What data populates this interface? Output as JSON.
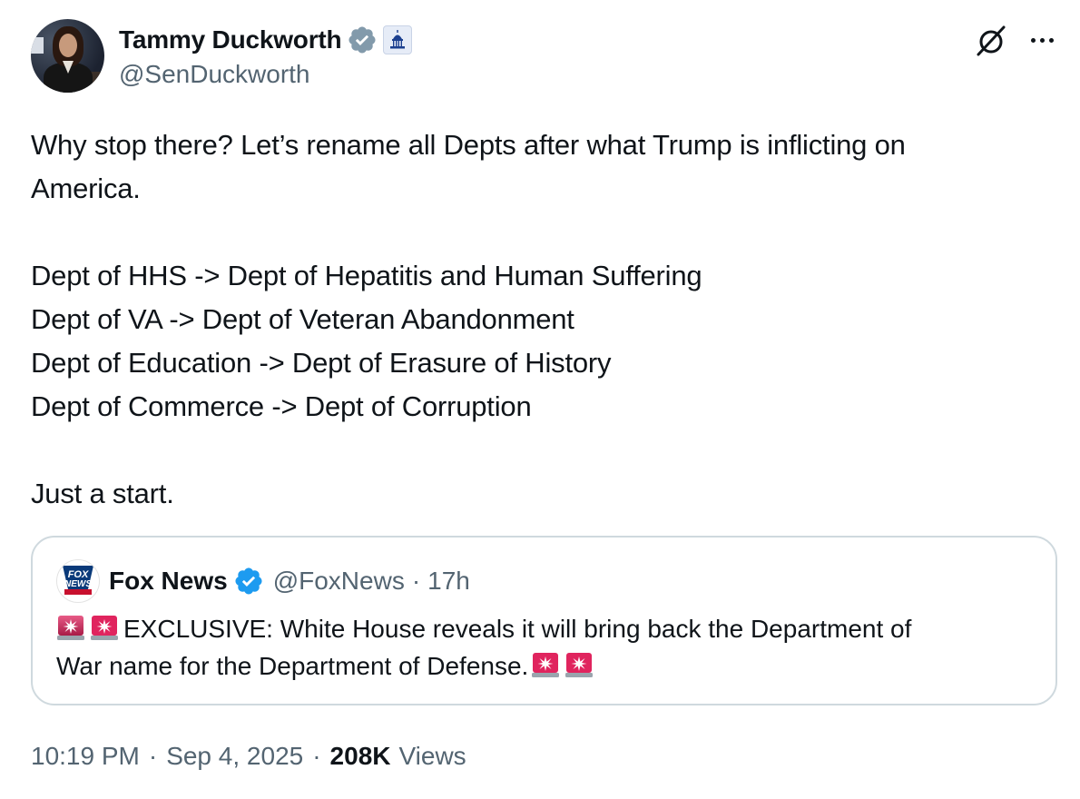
{
  "author": {
    "display_name": "Tammy Duckworth",
    "handle": "@SenDuckworth",
    "verified_badge": "gray-verified-badge-icon",
    "affiliation_icon": "us-capitol-icon"
  },
  "header_actions": {
    "grok_icon": "grok-icon",
    "more_icon": "more-icon"
  },
  "tweet": {
    "lines": [
      "Why stop there? Let’s rename all Depts after what Trump is inflicting on",
      "America.",
      "",
      "Dept of HHS -> Dept of Hepatitis and Human Suffering",
      "Dept of VA -> Dept of Veteran Abandonment",
      "Dept of Education -> Dept of Erasure of History",
      "Dept of Commerce -> Dept of Corruption",
      "",
      "Just a start."
    ]
  },
  "quote": {
    "logo": "fox-news-logo",
    "display_name": "Fox News",
    "verified_badge": "blue-verified-badge-icon",
    "handle": "@FoxNews",
    "separator": "·",
    "time": "17h",
    "line1": "EXCLUSIVE: White House reveals it will bring back the Department of",
    "line2": "War name for the Department of Defense.",
    "emoji": "rotating-light-icon"
  },
  "footer": {
    "time": "10:19 PM",
    "separator": "·",
    "date": "Sep 4, 2025",
    "views_count": "208K",
    "views_label": "Views"
  },
  "colors": {
    "text": "#0f1419",
    "muted": "#536471",
    "border": "#cfd9de",
    "blue_badge": "#1d9bf0",
    "gray_badge": "#829aab",
    "fox_red": "#c8102e",
    "fox_blue": "#0a3a7a"
  }
}
